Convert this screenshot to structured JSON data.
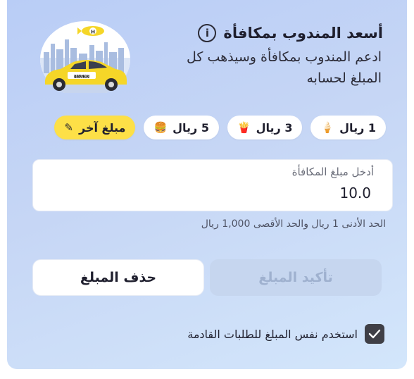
{
  "header": {
    "title": "أسعد المندوب بمكافأة",
    "info_glyph": "i",
    "subtitle": "ادعم المندوب بمكافأة وسيذهب كل المبلغ لحسابه"
  },
  "illustration": {
    "van_text_top": "HUNGER",
    "van_text_bottom": "STATION",
    "blimp_letter": "H"
  },
  "tips": [
    {
      "label": "1 ريال",
      "icon": "ice-cream-icon",
      "emoji": "🍦"
    },
    {
      "label": "3 ريال",
      "icon": "fries-icon",
      "emoji": "🍟"
    },
    {
      "label": "5 ريال",
      "icon": "burger-icon",
      "emoji": "🍔"
    },
    {
      "label": "مبلغ آخر",
      "icon": "pencil-icon",
      "emoji": "✎"
    }
  ],
  "amount_input": {
    "label": "أدخل مبلغ المكافأة",
    "value": "10.0"
  },
  "hint": "الحد الأدنى 1 ريال والحد الأقصى 1,000 ريال",
  "buttons": {
    "confirm": "تأكيد المبلغ",
    "delete": "حذف المبلغ"
  },
  "save_preference": {
    "label": "استخدم نفس المبلغ للطلبات القادمة",
    "checked": true
  },
  "colors": {
    "accent_yellow": "#fde047",
    "disabled_button": "#c6d6ef",
    "checkbox": "#3f3f46"
  }
}
